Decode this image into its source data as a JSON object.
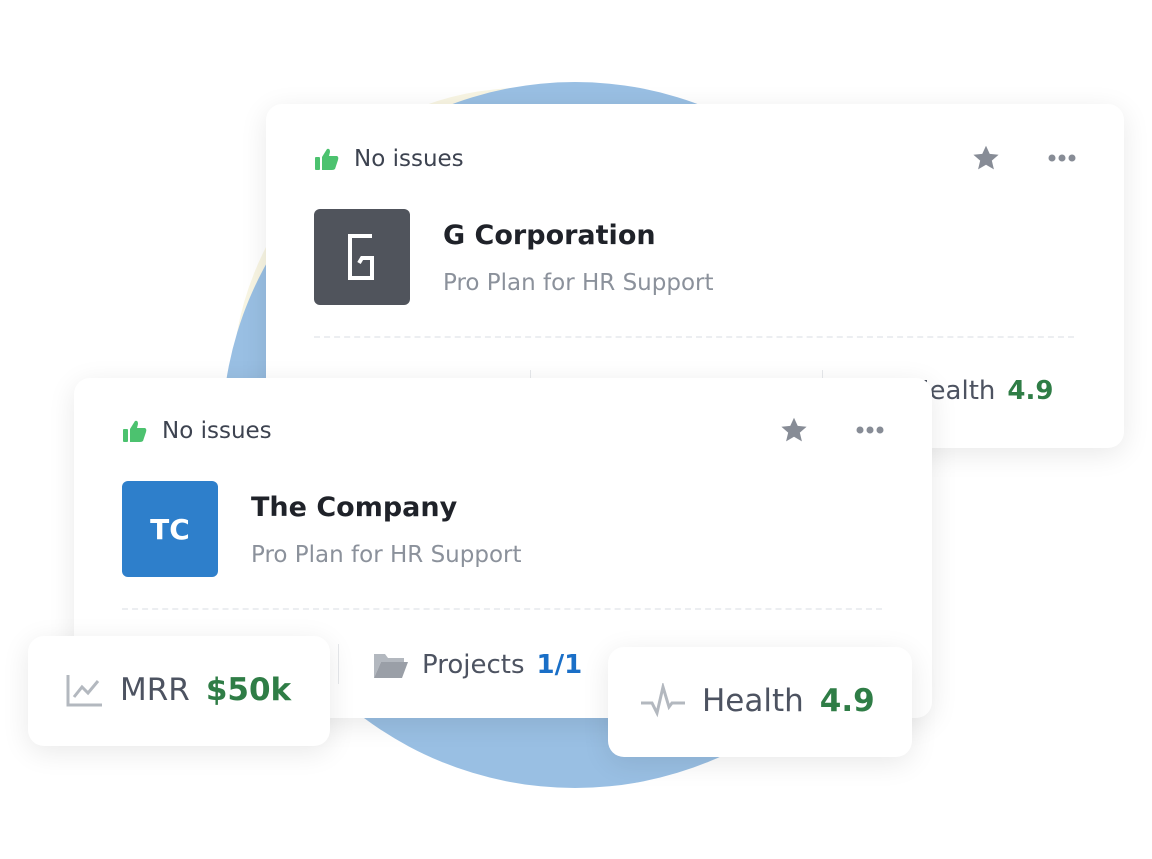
{
  "colors": {
    "accent_green": "#2f7d46",
    "thumb_green": "#4cc26f",
    "accent_blue": "#1a6fc7",
    "tc_logo": "#2e7fcb",
    "g_logo": "#50545c"
  },
  "back_card": {
    "status": "No issues",
    "status_icon": "thumbs-up-icon",
    "logo_letter": "G",
    "company": "G Corporation",
    "plan": "Pro Plan for HR Support",
    "health_label": "Health",
    "health_value": "4.9"
  },
  "front_card": {
    "status": "No issues",
    "status_icon": "thumbs-up-icon",
    "logo_initials": "TC",
    "company": "The Company",
    "plan": "Pro Plan for HR Support",
    "projects_label": "Projects",
    "projects_value": "1/1"
  },
  "mrr_card": {
    "label": "MRR",
    "value": "$50k",
    "icon": "line-chart-icon"
  },
  "health_card": {
    "label": "Health",
    "value": "4.9",
    "icon": "pulse-icon"
  }
}
